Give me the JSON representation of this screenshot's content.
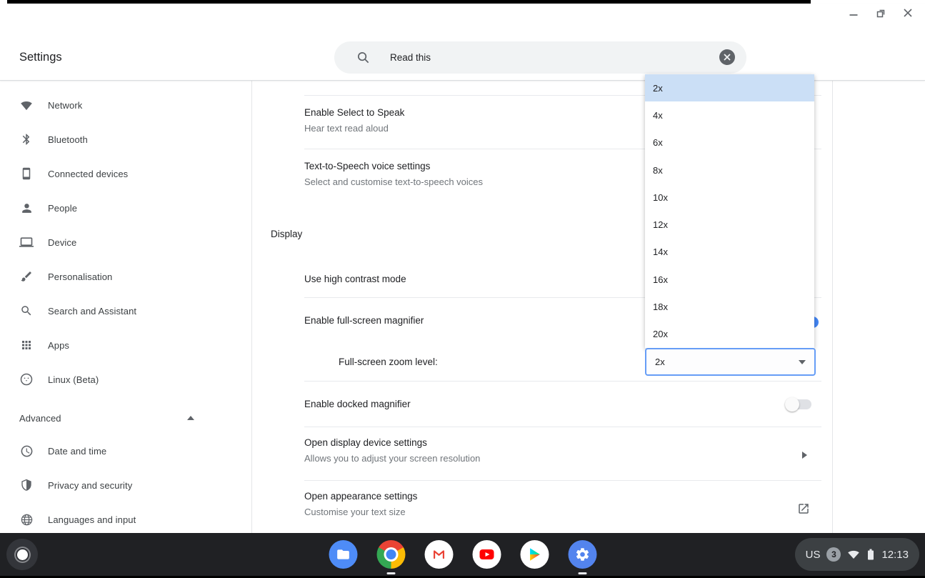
{
  "header": {
    "title": "Settings",
    "search": {
      "value": "Read this"
    }
  },
  "sidebar": {
    "items": [
      {
        "icon": "wifi",
        "label": "Network"
      },
      {
        "icon": "bluetooth",
        "label": "Bluetooth"
      },
      {
        "icon": "smartphone",
        "label": "Connected devices"
      },
      {
        "icon": "person",
        "label": "People"
      },
      {
        "icon": "laptop",
        "label": "Device"
      },
      {
        "icon": "brush",
        "label": "Personalisation"
      },
      {
        "icon": "magnifier",
        "label": "Search and Assistant"
      },
      {
        "icon": "apps-grid",
        "label": "Apps"
      },
      {
        "icon": "penguin",
        "label": "Linux (Beta)"
      }
    ],
    "advanced": {
      "label": "Advanced",
      "state": "expanded"
    },
    "advanced_items": [
      {
        "icon": "clock",
        "label": "Date and time"
      },
      {
        "icon": "shield",
        "label": "Privacy and security"
      },
      {
        "icon": "globe",
        "label": "Languages and input"
      }
    ]
  },
  "content": {
    "rows": [
      {
        "title": "Enable Select to Speak",
        "subtitle": "Hear text read aloud"
      },
      {
        "title": "Text-to-Speech voice settings",
        "subtitle": "Select and customise text-to-speech voices"
      }
    ],
    "section": "Display",
    "high_contrast": {
      "title": "Use high contrast mode"
    },
    "fullscreen_magnifier": {
      "title": "Enable full-screen magnifier",
      "toggle": "on"
    },
    "zoom_level": {
      "label": "Full-screen zoom level:",
      "value": "2x"
    },
    "docked_magnifier": {
      "title": "Enable docked magnifier",
      "toggle": "off"
    },
    "display_device": {
      "title": "Open display device settings",
      "subtitle": "Allows you to adjust your screen resolution"
    },
    "appearance": {
      "title": "Open appearance settings",
      "subtitle": "Customise your text size"
    }
  },
  "dropdown": {
    "options": [
      "2x",
      "4x",
      "6x",
      "8x",
      "10x",
      "12x",
      "14x",
      "16x",
      "18x",
      "20x"
    ],
    "selected": "2x"
  },
  "shelf": {
    "apps": [
      "Files",
      "Chrome",
      "Gmail",
      "YouTube",
      "Play Store",
      "Settings"
    ],
    "running": [
      "Chrome",
      "Settings"
    ],
    "status": {
      "keyboard": "US",
      "badge": "3",
      "time": "12:13"
    }
  },
  "colors": {
    "accent": "#4285f4",
    "selected_item_bg": "#cbdff6",
    "select_border": "#669df6",
    "shelf_bg": "#202124",
    "status_pill_bg": "#3c4043"
  }
}
